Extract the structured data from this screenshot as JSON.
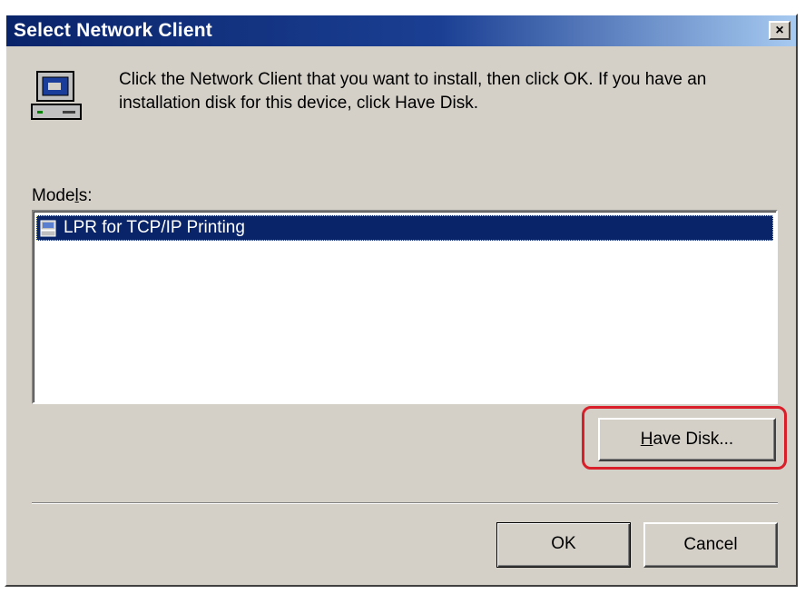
{
  "window": {
    "title": "Select Network Client",
    "close_label": "×"
  },
  "instructions": "Click the Network Client that you want to install, then click OK. If you have an installation disk for this device, click Have Disk.",
  "models": {
    "label_prefix": "Mode",
    "label_underline": "l",
    "label_suffix": "s:",
    "items": [
      {
        "label": "LPR for TCP/IP Printing",
        "selected": true
      }
    ]
  },
  "buttons": {
    "have_disk_underline": "H",
    "have_disk_rest": "ave Disk...",
    "ok": "OK",
    "cancel": "Cancel"
  },
  "colors": {
    "title_bar": "#0a246a",
    "selection": "#0a246a",
    "highlight_annotation": "#d9202a",
    "dialog_face": "#d4d0c8"
  },
  "icons": {
    "client": "network-client-icon",
    "item": "printer-icon",
    "close": "close-icon"
  }
}
